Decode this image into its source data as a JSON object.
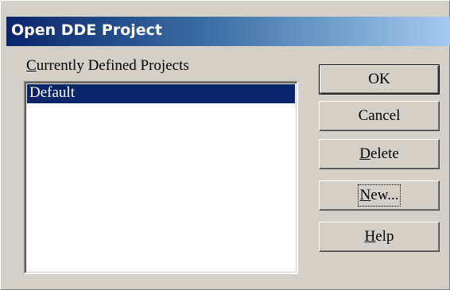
{
  "dialog": {
    "title": "Open DDE Project"
  },
  "projects": {
    "label_mnemonic": "C",
    "label_rest": "urrently Defined Projects",
    "items": [
      {
        "name": "Default",
        "selected": true
      }
    ]
  },
  "buttons": {
    "ok": {
      "label": "OK"
    },
    "cancel": {
      "label": "Cancel"
    },
    "delete": {
      "mnemonic": "D",
      "rest": "elete"
    },
    "new": {
      "mnemonic": "N",
      "rest": "ew..."
    },
    "help": {
      "mnemonic": "H",
      "rest": "elp"
    }
  },
  "colors": {
    "title_bar_start": "#0a246a",
    "title_bar_end": "#a6caf0",
    "selection": "#0a246a",
    "face": "#d4d0c8"
  }
}
